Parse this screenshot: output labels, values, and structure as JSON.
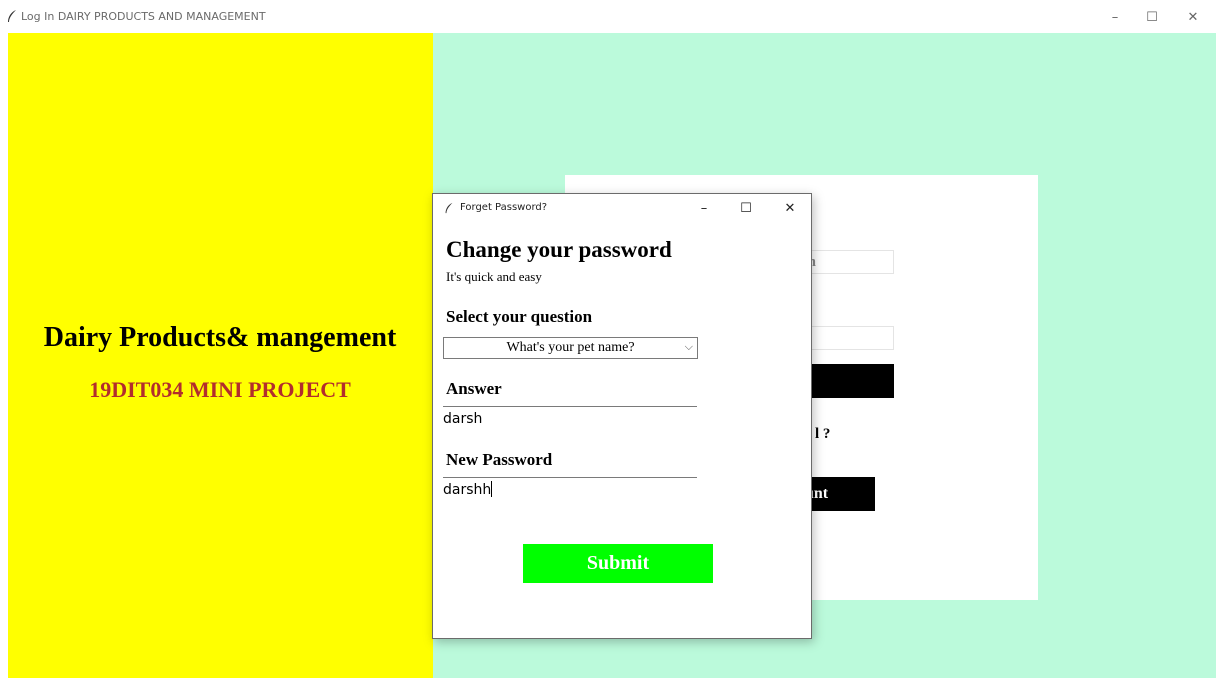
{
  "window": {
    "title": "Log In DAIRY PRODUCTS AND MANAGEMENT",
    "minimize": "–",
    "maximize": "☐",
    "close": "✕"
  },
  "left_panel": {
    "title": "Dairy Products& mangement",
    "subtitle": "19DIT034 MINI PROJECT"
  },
  "login_card": {
    "field1_partial": "om",
    "forgot_partial": "l ?",
    "button2_partial": "unt"
  },
  "dialog": {
    "title": "Forget Password?",
    "minimize": "–",
    "maximize": "☐",
    "close": "✕",
    "heading": "Change your password",
    "subheading": "It's quick and easy",
    "question_label": "Select your question",
    "question_value": "What's your pet name?",
    "answer_label": "Answer",
    "answer_value": "darsh",
    "new_password_label": "New Password",
    "new_password_value": "darshh",
    "submit_label": "Submit"
  },
  "colors": {
    "left_panel": "#ffff00",
    "right_panel": "#bbfadb",
    "subtitle": "#b22d2d",
    "submit": "#00ff00"
  },
  "icons": [
    "feather-icon",
    "chevron-down-icon"
  ]
}
